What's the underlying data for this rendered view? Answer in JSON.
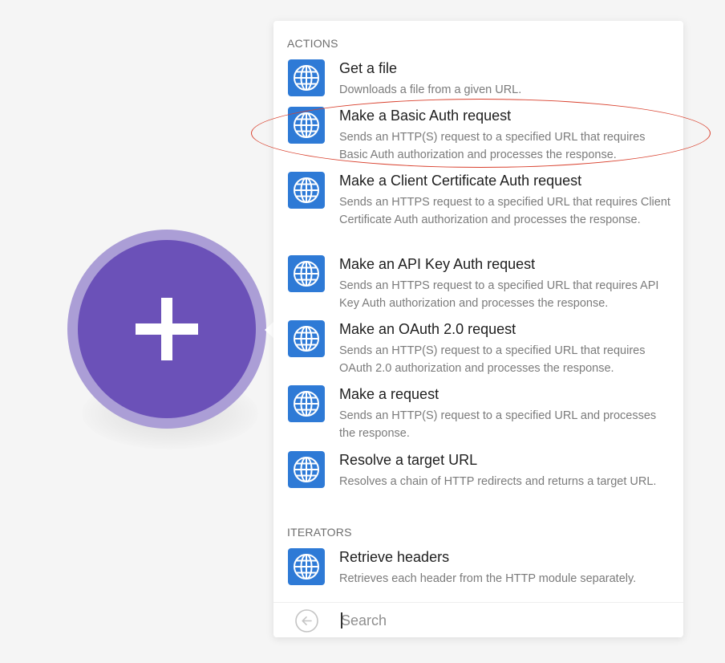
{
  "add_module": {
    "icon": "plus-icon",
    "colors": {
      "outer": "#ab9ed6",
      "inner": "#6b51b8"
    }
  },
  "panel": {
    "sections": [
      {
        "header": "ACTIONS",
        "items": [
          {
            "title": "Get a file",
            "description": "Downloads a file from a given URL.",
            "icon": "globe-icon"
          },
          {
            "title": "Make a Basic Auth request",
            "description": "Sends an HTTP(S) request to a specified URL that requires Basic Auth authorization and processes the response.",
            "icon": "globe-icon",
            "highlighted": true
          },
          {
            "title": "Make a Client Certificate Auth request",
            "description": "Sends an HTTPS request to a specified URL that requires Client Certificate Auth authorization and processes the response.",
            "icon": "globe-icon"
          },
          {
            "title": "Make an API Key Auth request",
            "description": "Sends an HTTPS request to a specified URL that requires API Key Auth authorization and processes the response.",
            "icon": "globe-icon"
          },
          {
            "title": "Make an OAuth 2.0 request",
            "description": "Sends an HTTP(S) request to a specified URL that requires OAuth 2.0 authorization and processes the response.",
            "icon": "globe-icon"
          },
          {
            "title": "Make a request",
            "description": "Sends an HTTP(S) request to a specified URL and processes the response.",
            "icon": "globe-icon"
          },
          {
            "title": "Resolve a target URL",
            "description": "Resolves a chain of HTTP redirects and returns a target URL.",
            "icon": "globe-icon"
          }
        ]
      },
      {
        "header": "ITERATORS",
        "items": [
          {
            "title": "Retrieve headers",
            "description": "Retrieves each header from the HTTP module separately.",
            "icon": "globe-icon"
          }
        ]
      }
    ]
  },
  "search": {
    "placeholder": "Search",
    "value": "",
    "back_icon": "arrow-left-circle-icon"
  },
  "colors": {
    "app_icon_bg": "#2e7ad6",
    "highlight": "#d9412e"
  }
}
